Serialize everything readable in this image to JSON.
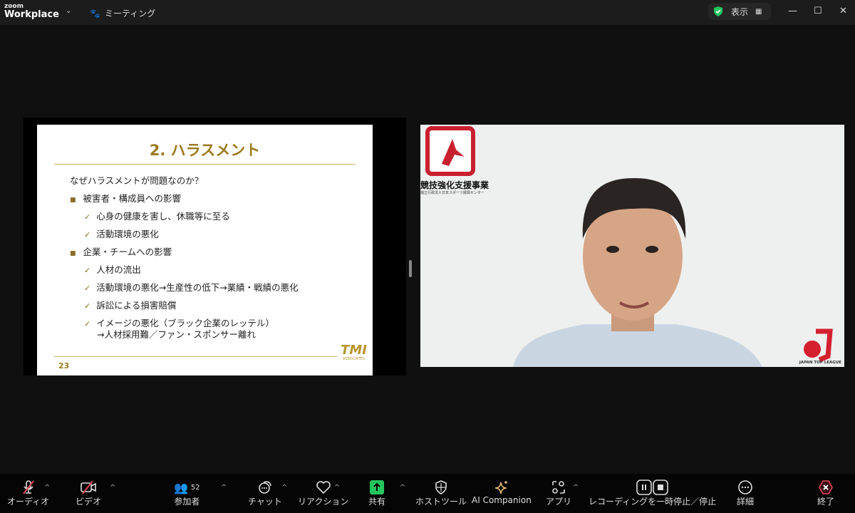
{
  "app": {
    "logo_top": "zoom",
    "logo_bottom": "Workplace",
    "meeting_label": "ミーティング",
    "view_label": "表示"
  },
  "slide": {
    "title": "2. ハラスメント",
    "question": "なぜハラスメントが問題なのか？",
    "sections": [
      {
        "heading": "被害者・構成員への影響",
        "items": [
          "心身の健康を害し、休職等に至る",
          "活動環境の悪化"
        ]
      },
      {
        "heading": "企業・チームへの影響",
        "items": [
          "人材の流出",
          "活動環境の悪化→生産性の低下→業績・戦績の悪化",
          "訴訟による損害賠償",
          "イメージの悪化（ブラック企業のレッテル）"
        ]
      }
    ],
    "continuation": "→人材採用難／ファン・スポンサー離れ",
    "page_number": "23",
    "logo_text": "ASSOCIATES",
    "accent": "#9b7a1e"
  },
  "video": {
    "banner_text": "競技強化支援事業",
    "banner_sub": "独立行政法人日本スポーツ振興センター",
    "league_logo": "JAPAN TOP LEAGUE"
  },
  "toolbar": {
    "audio": "オーディオ",
    "video": "ビデオ",
    "participants": "参加者",
    "participant_count": "52",
    "chat": "チャット",
    "reactions": "リアクション",
    "share": "共有",
    "host_tools": "ホストツール",
    "ai": "AI Companion",
    "apps": "アプリ",
    "recording": "レコーディングを一時停止／停止",
    "more": "詳細",
    "end": "終了",
    "share_color": "#22c55e",
    "end_color": "#e0475a"
  }
}
